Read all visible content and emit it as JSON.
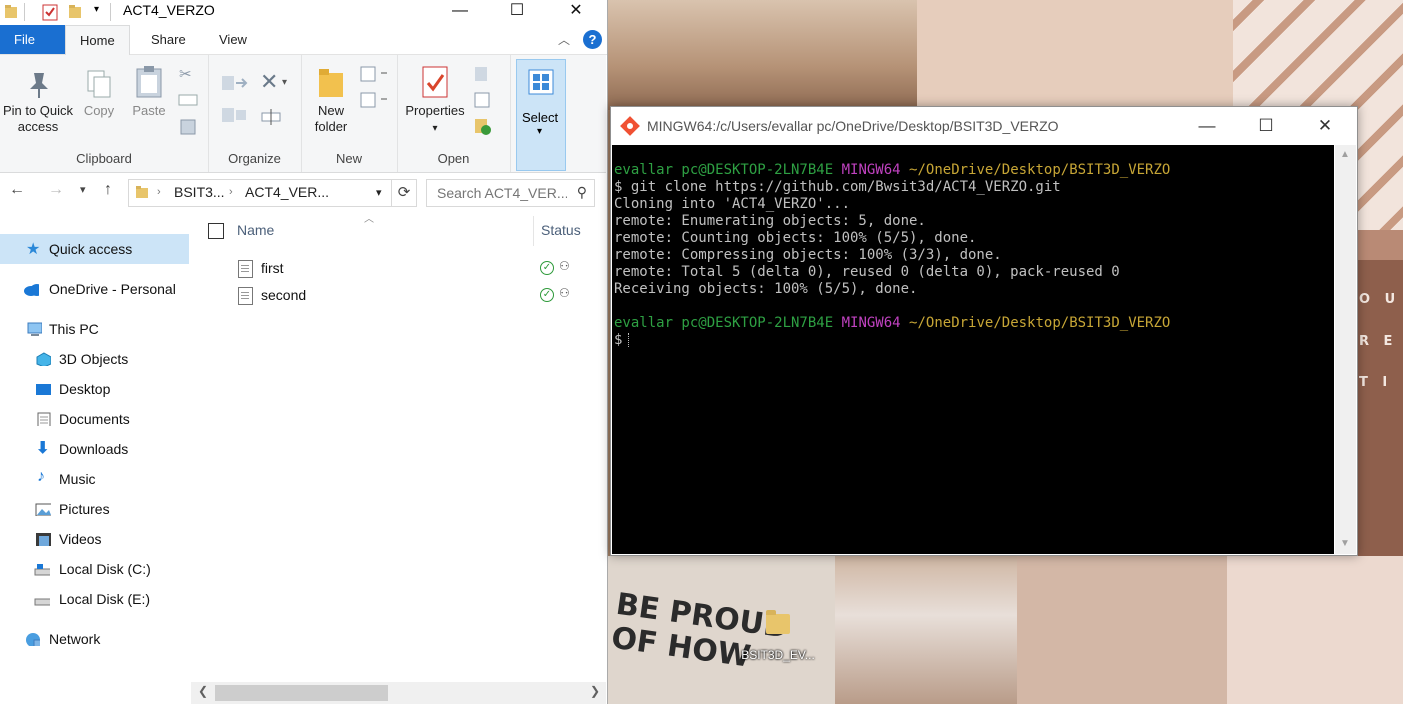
{
  "explorer": {
    "title": "ACT4_VERZO",
    "tabs": {
      "file": "File",
      "home": "Home",
      "share": "Share",
      "view": "View"
    },
    "ribbon": {
      "clipboard": {
        "group": "Clipboard",
        "pin_line1": "Pin to Quick",
        "pin_line2": "access",
        "copy": "Copy",
        "paste": "Paste"
      },
      "organize": {
        "group": "Organize"
      },
      "new": {
        "group": "New",
        "new_folder_line1": "New",
        "new_folder_line2": "folder"
      },
      "open": {
        "group": "Open",
        "properties": "Properties"
      },
      "select": {
        "label": "Select"
      }
    },
    "address": {
      "crumbs": [
        "BSIT3...",
        "ACT4_VER..."
      ],
      "search_placeholder": "Search ACT4_VER..."
    },
    "nav": [
      {
        "label": "Quick access",
        "icon": "star-icon",
        "selected": true
      },
      {
        "label": "OneDrive - Personal",
        "icon": "cloud-icon"
      },
      {
        "label": "This PC",
        "icon": "computer-icon"
      },
      {
        "label": "3D Objects",
        "icon": "cube-icon"
      },
      {
        "label": "Desktop",
        "icon": "desktop-icon"
      },
      {
        "label": "Documents",
        "icon": "document-icon"
      },
      {
        "label": "Downloads",
        "icon": "download-icon"
      },
      {
        "label": "Music",
        "icon": "music-icon"
      },
      {
        "label": "Pictures",
        "icon": "pictures-icon"
      },
      {
        "label": "Videos",
        "icon": "videos-icon"
      },
      {
        "label": "Local Disk (C:)",
        "icon": "drive-icon"
      },
      {
        "label": "Local Disk (E:)",
        "icon": "drive-icon"
      },
      {
        "label": "Network",
        "icon": "network-icon"
      }
    ],
    "columns": {
      "name": "Name",
      "status": "Status"
    },
    "files": [
      {
        "name": "first"
      },
      {
        "name": "second"
      }
    ]
  },
  "terminal": {
    "title": "MINGW64:/c/Users/evallar pc/OneDrive/Desktop/BSIT3D_VERZO",
    "lines": [
      {
        "user": "evallar pc@DESKTOP-2LN7B4E",
        "env": "MINGW64",
        "path": "~/OneDrive/Desktop/BSIT3D_VERZO"
      },
      {
        "text": "$ git clone https://github.com/Bwsit3d/ACT4_VERZO.git"
      },
      {
        "text": "Cloning into 'ACT4_VERZO'..."
      },
      {
        "text": "remote: Enumerating objects: 5, done."
      },
      {
        "text": "remote: Counting objects: 100% (5/5), done."
      },
      {
        "text": "remote: Compressing objects: 100% (3/3), done."
      },
      {
        "text": "remote: Total 5 (delta 0), reused 0 (delta 0), pack-reused 0"
      },
      {
        "text": "Receiving objects: 100% (5/5), done."
      },
      {
        "text": ""
      },
      {
        "user": "evallar pc@DESKTOP-2LN7B4E",
        "env": "MINGW64",
        "path": "~/OneDrive/Desktop/BSIT3D_VERZO"
      },
      {
        "text": "$"
      }
    ]
  },
  "desktop": {
    "icon_label": "BSIT3D_EV...",
    "wallpaper_text": "BE PROUD OF HOW",
    "wallpaper_letters": [
      "O U",
      "R E",
      "T I"
    ]
  },
  "colors": {
    "file_tab": "#1a6fd1",
    "selected_nav": "#cce4f7",
    "prompt_user": "#2ea043",
    "prompt_env": "#c042c0",
    "prompt_path": "#c7a636"
  }
}
